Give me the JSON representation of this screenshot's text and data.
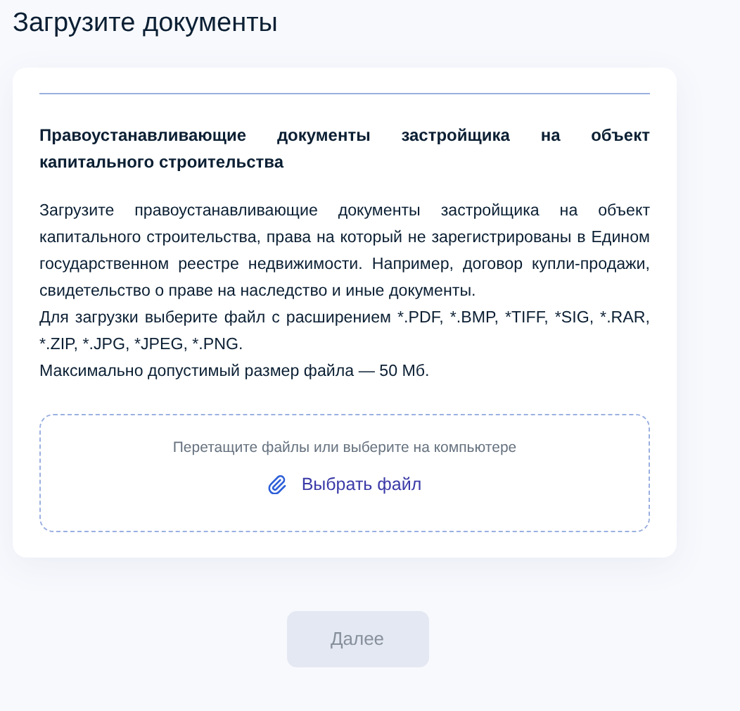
{
  "page_title": "Загрузите документы",
  "document": {
    "title": "Правоустанавливающие документы застройщика на объект капитального строительства",
    "description": [
      "Загрузите правоустанавливающие документы застройщика на объект капитального строительства, права на который не зарегистрированы в Едином государственном реестре недвижимости. Например, договор купли-продажи, свидетельство о праве на наследство и иные документы.",
      "Для загрузки выберите файл с расширением *.PDF, *.BMP, *TIFF, *SIG, *.RAR, *.ZIP, *.JPG, *JPEG, *.PNG.",
      "Максимально допустимый размер файла — 50 Мб."
    ],
    "dropzone": {
      "hint": "Перетащите файлы или выберите на компьютере",
      "button": "Выбрать файл"
    }
  },
  "next_button": {
    "label": "Далее",
    "disabled": true
  }
}
